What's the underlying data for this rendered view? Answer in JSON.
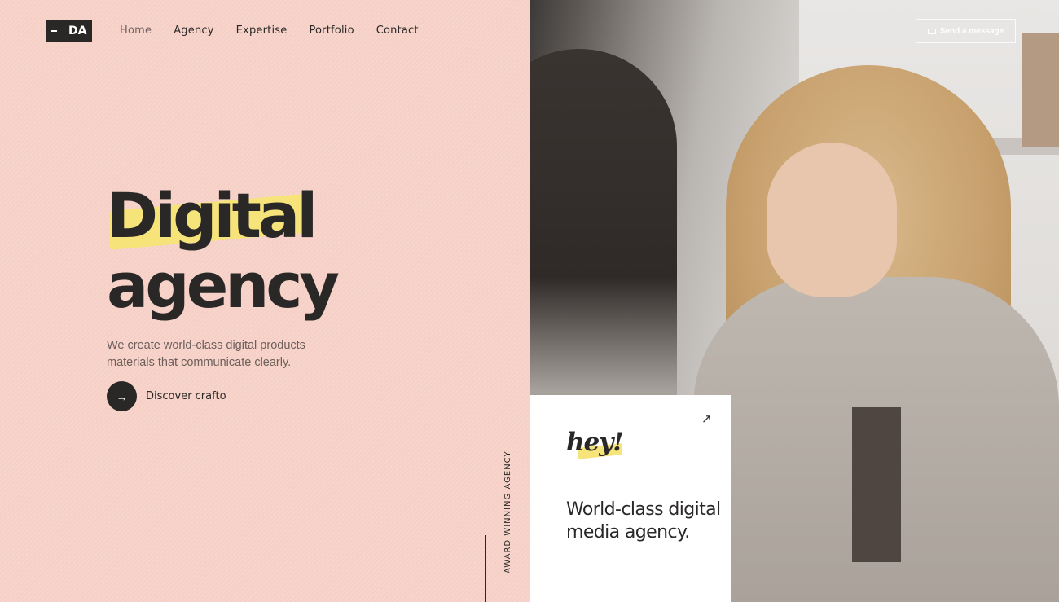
{
  "header": {
    "logo": "DA",
    "nav": [
      {
        "label": "Home",
        "active": true
      },
      {
        "label": "Agency"
      },
      {
        "label": "Expertise"
      },
      {
        "label": "Portfolio"
      },
      {
        "label": "Contact"
      }
    ],
    "send_message": "Send a message"
  },
  "hero": {
    "title_line1": "Digital",
    "title_line2": "agency",
    "description": "We create world-class digital products materials that communicate clearly.",
    "cta_label": "Discover crafto"
  },
  "side_label": "AWARD WINNING AGENCY",
  "card": {
    "greeting": "hey!",
    "tagline": "World-class digital media agency."
  },
  "colors": {
    "background": "#f6d0c6",
    "dark": "#2a2827",
    "accent_yellow": "#f6e37a"
  },
  "icons": {
    "cta": "arrow-right-icon",
    "card": "arrow-up-right-icon",
    "send": "envelope-icon"
  }
}
